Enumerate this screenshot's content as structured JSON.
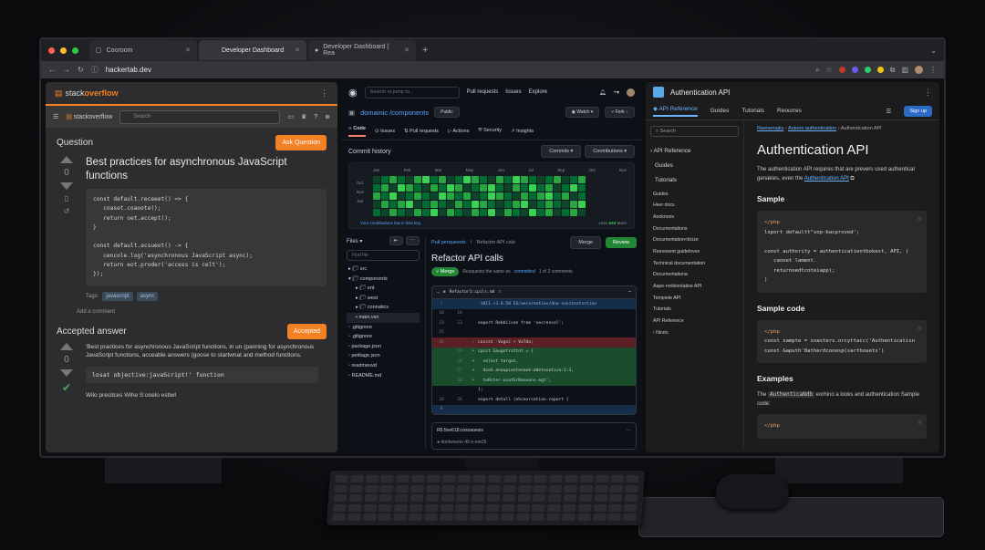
{
  "browser": {
    "tabs": [
      {
        "label": "Cooroom"
      },
      {
        "label": "Developer Dashboard"
      },
      {
        "label": "Developer Dashboard | Rea"
      }
    ],
    "new_tab": "+",
    "url": "hackertab.dev"
  },
  "stackoverflow": {
    "logo_prefix": "stack",
    "logo_suffix": "overflow",
    "search_placeholder": "Search",
    "section_title": "Question",
    "ask_button": "Ask Question",
    "question_votes": "0",
    "question_title": "Best practices for asynchronous JavaScript functions",
    "code": "const default.receeet() => {\n   coaset.coaoote();\n   return oet.accept();\n}\n\nconst default.acsueot() -> {\n   cencole.log('asynchronous JavaScript async);\n   return eot.proder('access is celt');\n});",
    "tags_label": "Tags:",
    "tags": [
      "javascript",
      "async"
    ],
    "add_comment": "Add a comment",
    "answer_title": "Accepted answer",
    "accepted_badge": "Accepted",
    "answer_votes": "0",
    "answer_text": "'Best practices for asynchronous JavaScript functions, in un (panning for asynchronous JavaScript functions, acceable answers (goose to startwnat and method functions.",
    "answer_code": "losat objective:javaScript!' function",
    "answer_last": "Wilo precitces Wihe S:ooelo estiwl"
  },
  "github": {
    "search_placeholder": "Search or jump to...",
    "nav": [
      "Pull requests",
      "Issues",
      "Explore"
    ],
    "repo_owner": "domainic",
    "repo_name": "/components",
    "repo_visibility": "Public",
    "watch_label": "Watch",
    "fork_label": "Fork",
    "tabs": [
      "Code",
      "Issues",
      "Pull requests",
      "Actions",
      "Security",
      "Insights"
    ],
    "commit_history": "Commit history",
    "commits_btn": "Commits",
    "contributions_btn": "Contributions",
    "months": [
      "Jan",
      "Feb",
      "Mar",
      "May",
      "Jun",
      "Jul",
      "Sep",
      "Oct",
      "Nov"
    ],
    "days": [
      "Oct",
      "Nov",
      "Jan"
    ],
    "heat_levels": [
      0,
      1,
      2,
      1,
      0,
      2,
      3,
      1,
      2,
      0,
      1,
      3,
      2,
      1,
      0,
      2,
      1,
      3,
      2,
      1,
      0,
      1,
      2,
      0,
      1,
      2,
      1,
      2,
      0,
      3,
      2,
      1,
      0,
      2,
      1,
      3,
      2,
      0,
      1,
      2,
      3,
      1,
      0,
      2,
      1,
      3,
      1,
      2,
      0,
      1,
      3,
      1,
      2,
      1,
      3,
      0,
      1,
      2,
      1,
      0,
      3,
      2,
      1,
      2,
      0,
      1,
      3,
      2,
      1,
      0,
      2,
      1,
      2,
      3,
      1,
      2,
      0,
      1,
      0,
      2,
      1,
      2,
      3,
      0,
      1,
      2,
      1,
      0,
      2,
      1,
      3,
      2,
      1,
      0,
      1,
      2,
      3,
      0,
      1,
      2,
      1,
      0,
      2,
      3,
      1,
      0,
      2,
      1,
      0,
      2,
      1,
      3,
      0,
      2,
      1,
      0,
      2,
      1,
      3,
      0,
      2,
      1,
      0,
      3,
      1,
      2,
      0,
      1,
      2,
      0
    ],
    "legend_left": "Your contributions low in less key.",
    "legend_less": "Less",
    "legend_more": "More",
    "files_label": "Files",
    "file_search": "Find file",
    "files": [
      "src",
      "components",
      "ent",
      "west",
      "connatics",
      "main.vsn",
      ".gitignore",
      ".gitignore",
      "package.json",
      "petitage.json",
      "readmeuvd",
      "README.md"
    ],
    "breadcrumb_link": "Pull perqueests",
    "breadcrumb_text": "Refactor API calo",
    "merge_btn": "Merge",
    "review_btn": "Review",
    "pr_title": "Refactor API calls",
    "merged_badge": "Merge",
    "merged_text_pre": "Rcuquests the same as",
    "merged_link": "committed",
    "merged_text_post": "1 of 2 comments",
    "diff_file": "Refactor1:cpils.md",
    "diff_rows": [
      {
        "k": "hunk",
        "a": "7",
        "b": "",
        "s": "",
        "t": "-1011 +3.0.58 ES/aeroreatios/dno-sunitextxstion"
      },
      {
        "k": "",
        "a": "18",
        "b": "18",
        "s": "",
        "t": ""
      },
      {
        "k": "",
        "a": "23",
        "b": "23",
        "s": "",
        "t": "export Rebbiicen from 'secrencel';"
      },
      {
        "k": "",
        "a": "25",
        "b": "",
        "s": "",
        "t": ""
      },
      {
        "k": "del",
        "a": "28",
        "b": "",
        "s": "-",
        "t": "cossst -Vogol + VoTde;"
      },
      {
        "k": "add",
        "a": "",
        "b": "19",
        "s": "+",
        "t": "cpcst Gaugstrsttnt = {"
      },
      {
        "k": "add",
        "a": "",
        "b": "16",
        "s": "+",
        "t": "  select targot,"
      },
      {
        "k": "add",
        "a": "",
        "b": "27",
        "s": "+",
        "t": "  dzeS.ehaupienteneok-ddetneotice:1:3,"
      },
      {
        "k": "add",
        "a": "",
        "b": "30",
        "s": "+",
        "t": "  teRcter-usatGrRanoens-egt',"
      },
      {
        "k": "",
        "a": "",
        "b": "",
        "s": "",
        "t": "};"
      },
      {
        "k": "",
        "a": "28",
        "b": "26",
        "s": "",
        "t": "export detoll (ehceorsation-report {"
      },
      {
        "k": "hunk",
        "a": "8",
        "b": "",
        "s": "",
        "t": ""
      }
    ],
    "comment_title": "R6:5ne618:cosoaoesis",
    "comment_user": "dontwoonn 49 e-nre25"
  },
  "docs": {
    "site_title": "Authentication API",
    "nav": [
      "API Reference",
      "Guides",
      "Tutorials",
      "Reourres"
    ],
    "signup": "Sign up",
    "search_placeholder": "Search",
    "side_main": [
      "API Reference",
      "Guides",
      "Tutorials"
    ],
    "side_sub": [
      "Guides",
      "Heer docs",
      "Aooknoos",
      "Documentations",
      "Documentation<ticize",
      "Reevosent guideloves",
      "Technical documentation",
      "Documentationa",
      "Aape-ronbinntatioe API",
      "Tempiete API",
      "Tutorials",
      "API Reference"
    ],
    "side_last": "Nirsto",
    "crumbs": [
      "Reenemaks",
      "Autonn authentication",
      "Authentication API"
    ],
    "h1": "Authentication API",
    "intro": "The authentication API requires that are prevers used authentical genakies, even the",
    "intro_link": "Authentication API",
    "sample_title": "Sample",
    "sample_code_kw": "</php",
    "sample_code": "\nlsport defaultt\"sop-bacproved';\n\nconst authority = authenticatientbokest, API, (\n   caooet lament.\n   returnoedtcoteiapp);\n)",
    "sample2_title": "Sample code",
    "sample2_kw": "</php",
    "sample2_code": "\nconst sampte = soasters.orcyttacc('Authenticatisn\nconst &aputh'8atherdconesp(sarthouets')",
    "examples_title": "Examples",
    "examples_pre": "The",
    "examples_code": "AuthenticaNdb",
    "examples_post": "eorhino a looks and authentication Sample code:",
    "examples_kw": "</php"
  },
  "colors": {
    "accent_so": "#f48024",
    "accent_gh": "#238636",
    "accent_docs": "#6cb4ff"
  }
}
